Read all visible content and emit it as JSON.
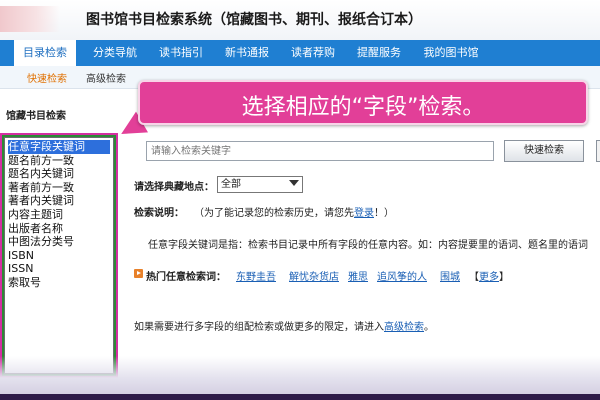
{
  "header": {
    "title": "图书馆书目检索系统（馆藏图书、期刊、报纸合订本）"
  },
  "nav": {
    "items": [
      "目录检索",
      "分类导航",
      "读书指引",
      "新书通报",
      "读者荐购",
      "提醒服务",
      "我的图书馆"
    ],
    "active": "目录检索"
  },
  "subnav": {
    "items": [
      "快速检索",
      "高级检索"
    ],
    "active": "快速检索"
  },
  "left_panel": {
    "title": "馆藏书目检索",
    "fields": [
      "任意字段关键词",
      "题名前方一致",
      "题名内关键词",
      "著者前方一致",
      "著者内关键词",
      "内容主题词",
      "出版者名称",
      "中图法分类号",
      "ISBN",
      "ISSN",
      "索取号"
    ],
    "selected": "任意字段关键词"
  },
  "callout": {
    "text": "选择相应的“字段”检索。"
  },
  "search": {
    "placeholder": "请输入检索关键字",
    "button": "快速检索"
  },
  "location": {
    "label": "请选择典藏地点：",
    "selected": "全部"
  },
  "help": {
    "label": "检索说明：",
    "note_before": "（为了能记录您的检索历史，请您先",
    "login_link": "登录",
    "note_after": "！）",
    "description": "任意字段关键词是指：检索书目记录中所有字段的任意内容。如：内容提要里的语词、题名里的语词"
  },
  "hot": {
    "label": "热门任意检索词：",
    "keywords": [
      "东野圭吾",
      "解忧杂货店",
      "雅思",
      "追风筝的人",
      "围城"
    ],
    "more": "更多",
    "more_open": "【",
    "more_close": "】"
  },
  "footer_note": {
    "text": "如果需要进行多字段的组配检索或做更多的限定，请进入",
    "link": "高级检索",
    "end": "。"
  },
  "colors": {
    "nav_blue": "#1f7fd2",
    "callout_pink": "#e23f98",
    "highlight_green": "#2c8a35",
    "subnav_active": "#e07000",
    "link_blue": "#1a5fb4"
  }
}
